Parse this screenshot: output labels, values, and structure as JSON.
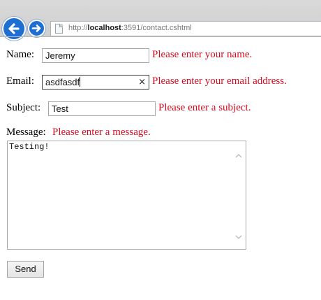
{
  "browser": {
    "url_prefix": "http://",
    "url_host": "localhost",
    "url_rest": ":3591/contact.cshtml"
  },
  "form": {
    "name": {
      "label": "Name:",
      "value": "Jeremy",
      "error": "Please enter your name."
    },
    "email": {
      "label": "Email:",
      "value": "asdfasdf",
      "error": "Please enter your email address.",
      "clear_glyph": "×"
    },
    "subject": {
      "label": "Subject:",
      "value": "Test",
      "error": "Please enter a subject."
    },
    "message": {
      "label": "Message:",
      "error": "Please enter a message.",
      "value": "Testing!"
    },
    "send_label": "Send"
  },
  "colors": {
    "error": "#d90a1e",
    "nav_button": "#1e6fd1"
  },
  "icons": {
    "back": "arrow-left-icon",
    "forward": "arrow-right-icon",
    "page": "page-icon",
    "clear": "close-icon",
    "scroll_up": "chevron-up-icon",
    "scroll_down": "chevron-down-icon"
  }
}
